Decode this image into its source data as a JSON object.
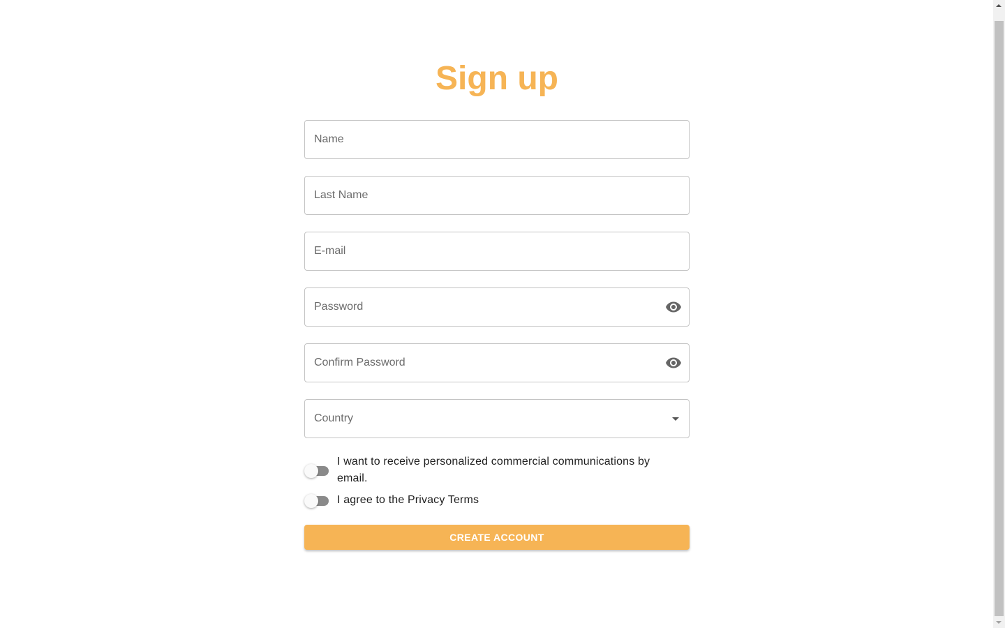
{
  "title": "Sign up",
  "fields": {
    "name": {
      "placeholder": "Name",
      "value": ""
    },
    "last_name": {
      "placeholder": "Last Name",
      "value": ""
    },
    "email": {
      "placeholder": "E-mail",
      "value": ""
    },
    "password": {
      "placeholder": "Password",
      "value": "",
      "icon": "eye-icon"
    },
    "confirm_password": {
      "placeholder": "Confirm Password",
      "value": "",
      "icon": "eye-icon"
    },
    "country": {
      "label": "Country",
      "icon": "chevron-down-icon"
    }
  },
  "toggles": {
    "marketing": {
      "label": "I want to receive personalized commercial communications by email.",
      "checked": false
    },
    "privacy": {
      "label": "I agree to the Privacy Terms",
      "checked": false
    }
  },
  "submit": {
    "label": "CREATE ACCOUNT"
  },
  "colors": {
    "accent": "#f6b455",
    "border": "#c4c4c4",
    "placeholder": "#6b6b6b",
    "switch_track": "#8a8a8a"
  }
}
